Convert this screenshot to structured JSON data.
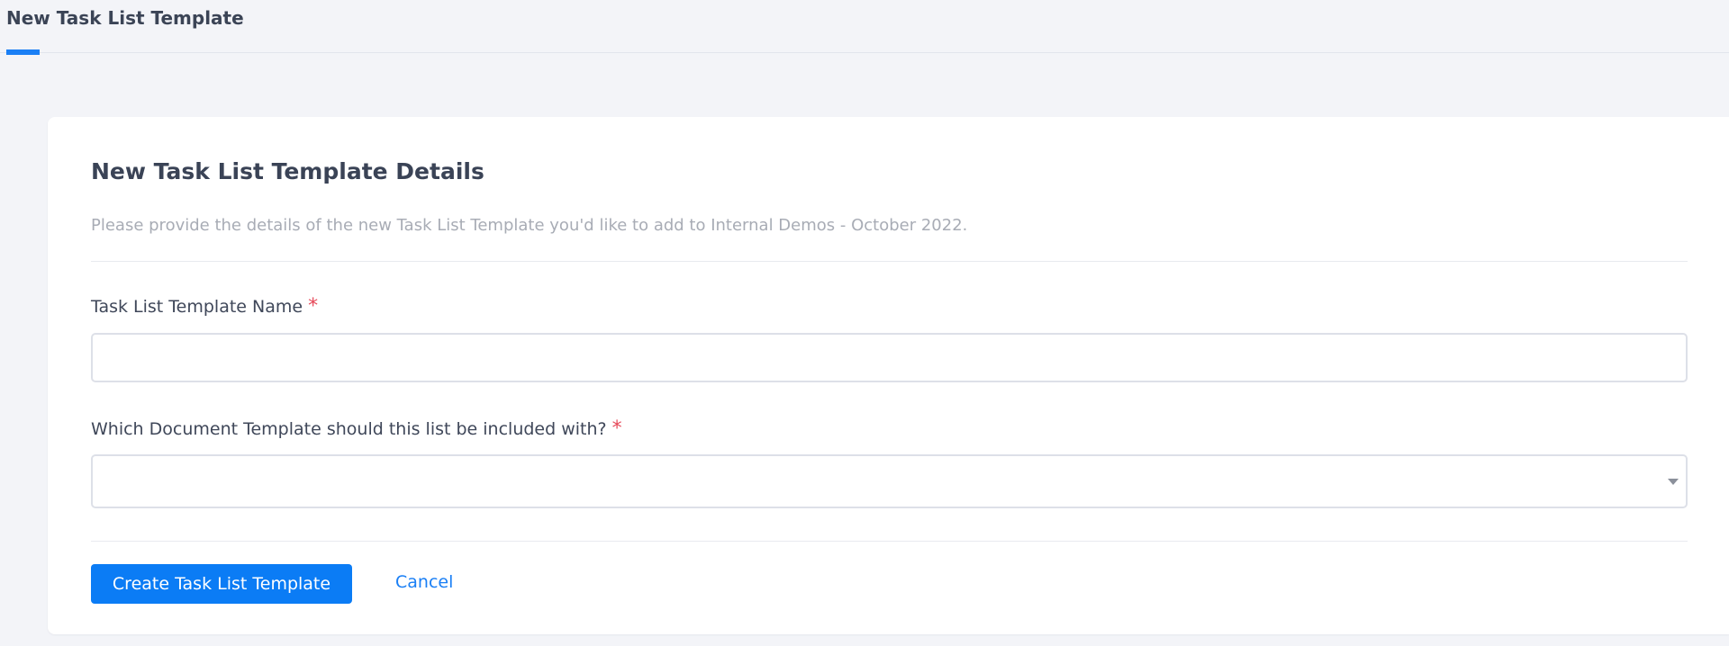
{
  "header": {
    "tab_label": "New Task List Template",
    "accent_color": "#1a7ff5"
  },
  "form": {
    "title": "New Task List Template Details",
    "subtitle": "Please provide the details of the new Task List Template you'd like to add to Internal Demos - October 2022.",
    "fields": {
      "name": {
        "label": "Task List Template Name",
        "required_mark": "*",
        "value": ""
      },
      "document_template": {
        "label": "Which Document Template should this list be included with?",
        "required_mark": "*",
        "selected": ""
      }
    },
    "actions": {
      "submit_label": "Create Task List Template",
      "cancel_label": "Cancel",
      "primary_color": "#0b7cf5"
    }
  }
}
